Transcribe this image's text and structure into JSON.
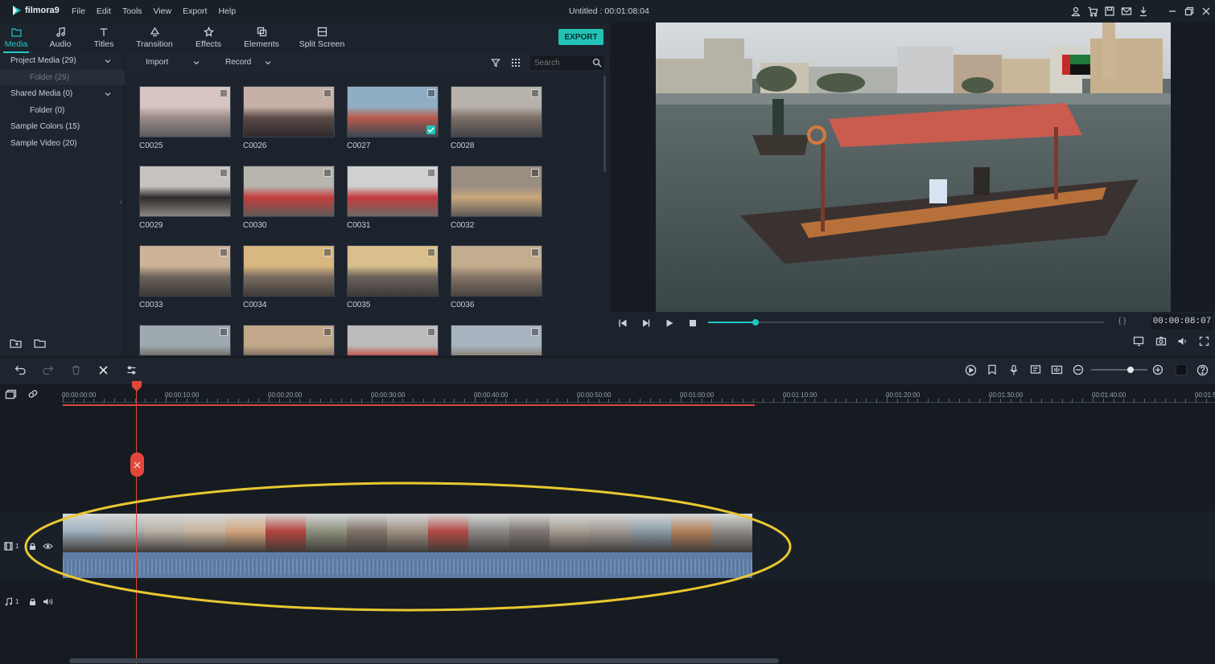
{
  "app": {
    "name": "filmora9",
    "menu": [
      "File",
      "Edit",
      "Tools",
      "View",
      "Export",
      "Help"
    ],
    "doc_title": "Untitled : 00:01:08:04"
  },
  "tabs": [
    {
      "label": "Media",
      "icon": "folder-icon",
      "active": true
    },
    {
      "label": "Audio",
      "icon": "music-note-icon",
      "active": false
    },
    {
      "label": "Titles",
      "icon": "text-icon",
      "active": false
    },
    {
      "label": "Transition",
      "icon": "transition-icon",
      "active": false
    },
    {
      "label": "Effects",
      "icon": "effects-icon",
      "active": false
    },
    {
      "label": "Elements",
      "icon": "elements-icon",
      "active": false
    },
    {
      "label": "Split Screen",
      "icon": "split-screen-icon",
      "active": false
    }
  ],
  "export_label": "EXPORT",
  "library": {
    "items": [
      {
        "label": "Project Media (29)",
        "sub": false,
        "expandable": true
      },
      {
        "label": "Folder (29)",
        "sub": true,
        "expandable": false
      },
      {
        "label": "Shared Media (0)",
        "sub": false,
        "expandable": true
      },
      {
        "label": "Folder (0)",
        "sub": true,
        "expandable": false
      },
      {
        "label": "Sample Colors (15)",
        "sub": false,
        "expandable": false
      },
      {
        "label": "Sample Video (20)",
        "sub": false,
        "expandable": false
      }
    ]
  },
  "media_toolbar": {
    "import_label": "Import",
    "record_label": "Record",
    "search_placeholder": "Search"
  },
  "clips": [
    {
      "label": "C0025",
      "checked": false
    },
    {
      "label": "C0026",
      "checked": false
    },
    {
      "label": "C0027",
      "checked": true
    },
    {
      "label": "C0028",
      "checked": false
    },
    {
      "label": "C0029",
      "checked": false
    },
    {
      "label": "C0030",
      "checked": false
    },
    {
      "label": "C0031",
      "checked": false
    },
    {
      "label": "C0032",
      "checked": false
    },
    {
      "label": "C0033",
      "checked": false
    },
    {
      "label": "C0034",
      "checked": false
    },
    {
      "label": "C0035",
      "checked": false
    },
    {
      "label": "C0036",
      "checked": false
    },
    {
      "label": "",
      "checked": false
    },
    {
      "label": "",
      "checked": false
    },
    {
      "label": "",
      "checked": false
    },
    {
      "label": "",
      "checked": false
    }
  ],
  "player": {
    "timecode": "00:00:08:07",
    "progress": 0.12
  },
  "timeline": {
    "ruler_labels": [
      "00:00:00:00",
      "00:00:10:00",
      "00:00:20:00",
      "00:00:30:00",
      "00:00:40:00",
      "00:00:50:00",
      "00:01:00:00",
      "00:01:10:00",
      "00:01:20:00",
      "00:01:30:00",
      "00:01:40:00",
      "00:01:5"
    ],
    "zoom": 0.7,
    "video_track_label": "1",
    "audio_track_label": "1"
  },
  "colors": {
    "accent": "#22c7c7",
    "export": "#22c2b5",
    "playhead": "#e3473b",
    "highlight_ellipse": "#e8c832",
    "clip_strip": "#5e7da6"
  }
}
